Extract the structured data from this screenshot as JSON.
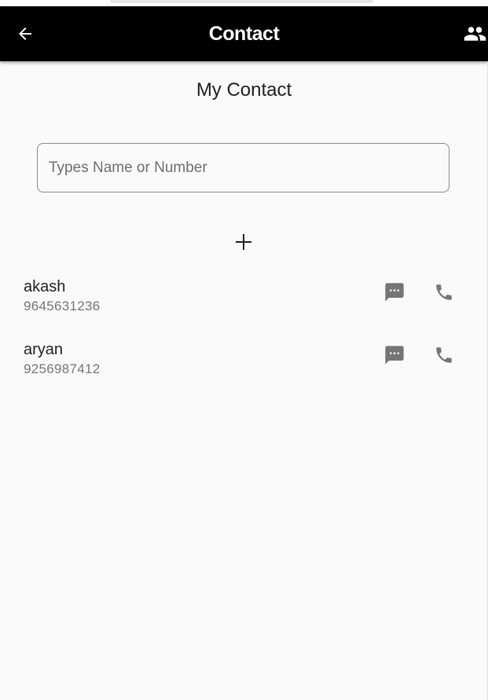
{
  "app_bar": {
    "title": "Contact",
    "back_icon": "arrow-back-icon",
    "contacts_icon": "people-icon"
  },
  "heading": "My Contact",
  "search": {
    "placeholder": "Types Name or Number",
    "value": ""
  },
  "add_icon": "plus-icon",
  "contacts": [
    {
      "name": "akash",
      "number": "9645631236"
    },
    {
      "name": "aryan",
      "number": "9256987412"
    }
  ],
  "colors": {
    "app_bar_bg": "#000000",
    "app_bar_text": "#ffffff",
    "background": "#fafafa",
    "icon_grey": "#757575"
  }
}
